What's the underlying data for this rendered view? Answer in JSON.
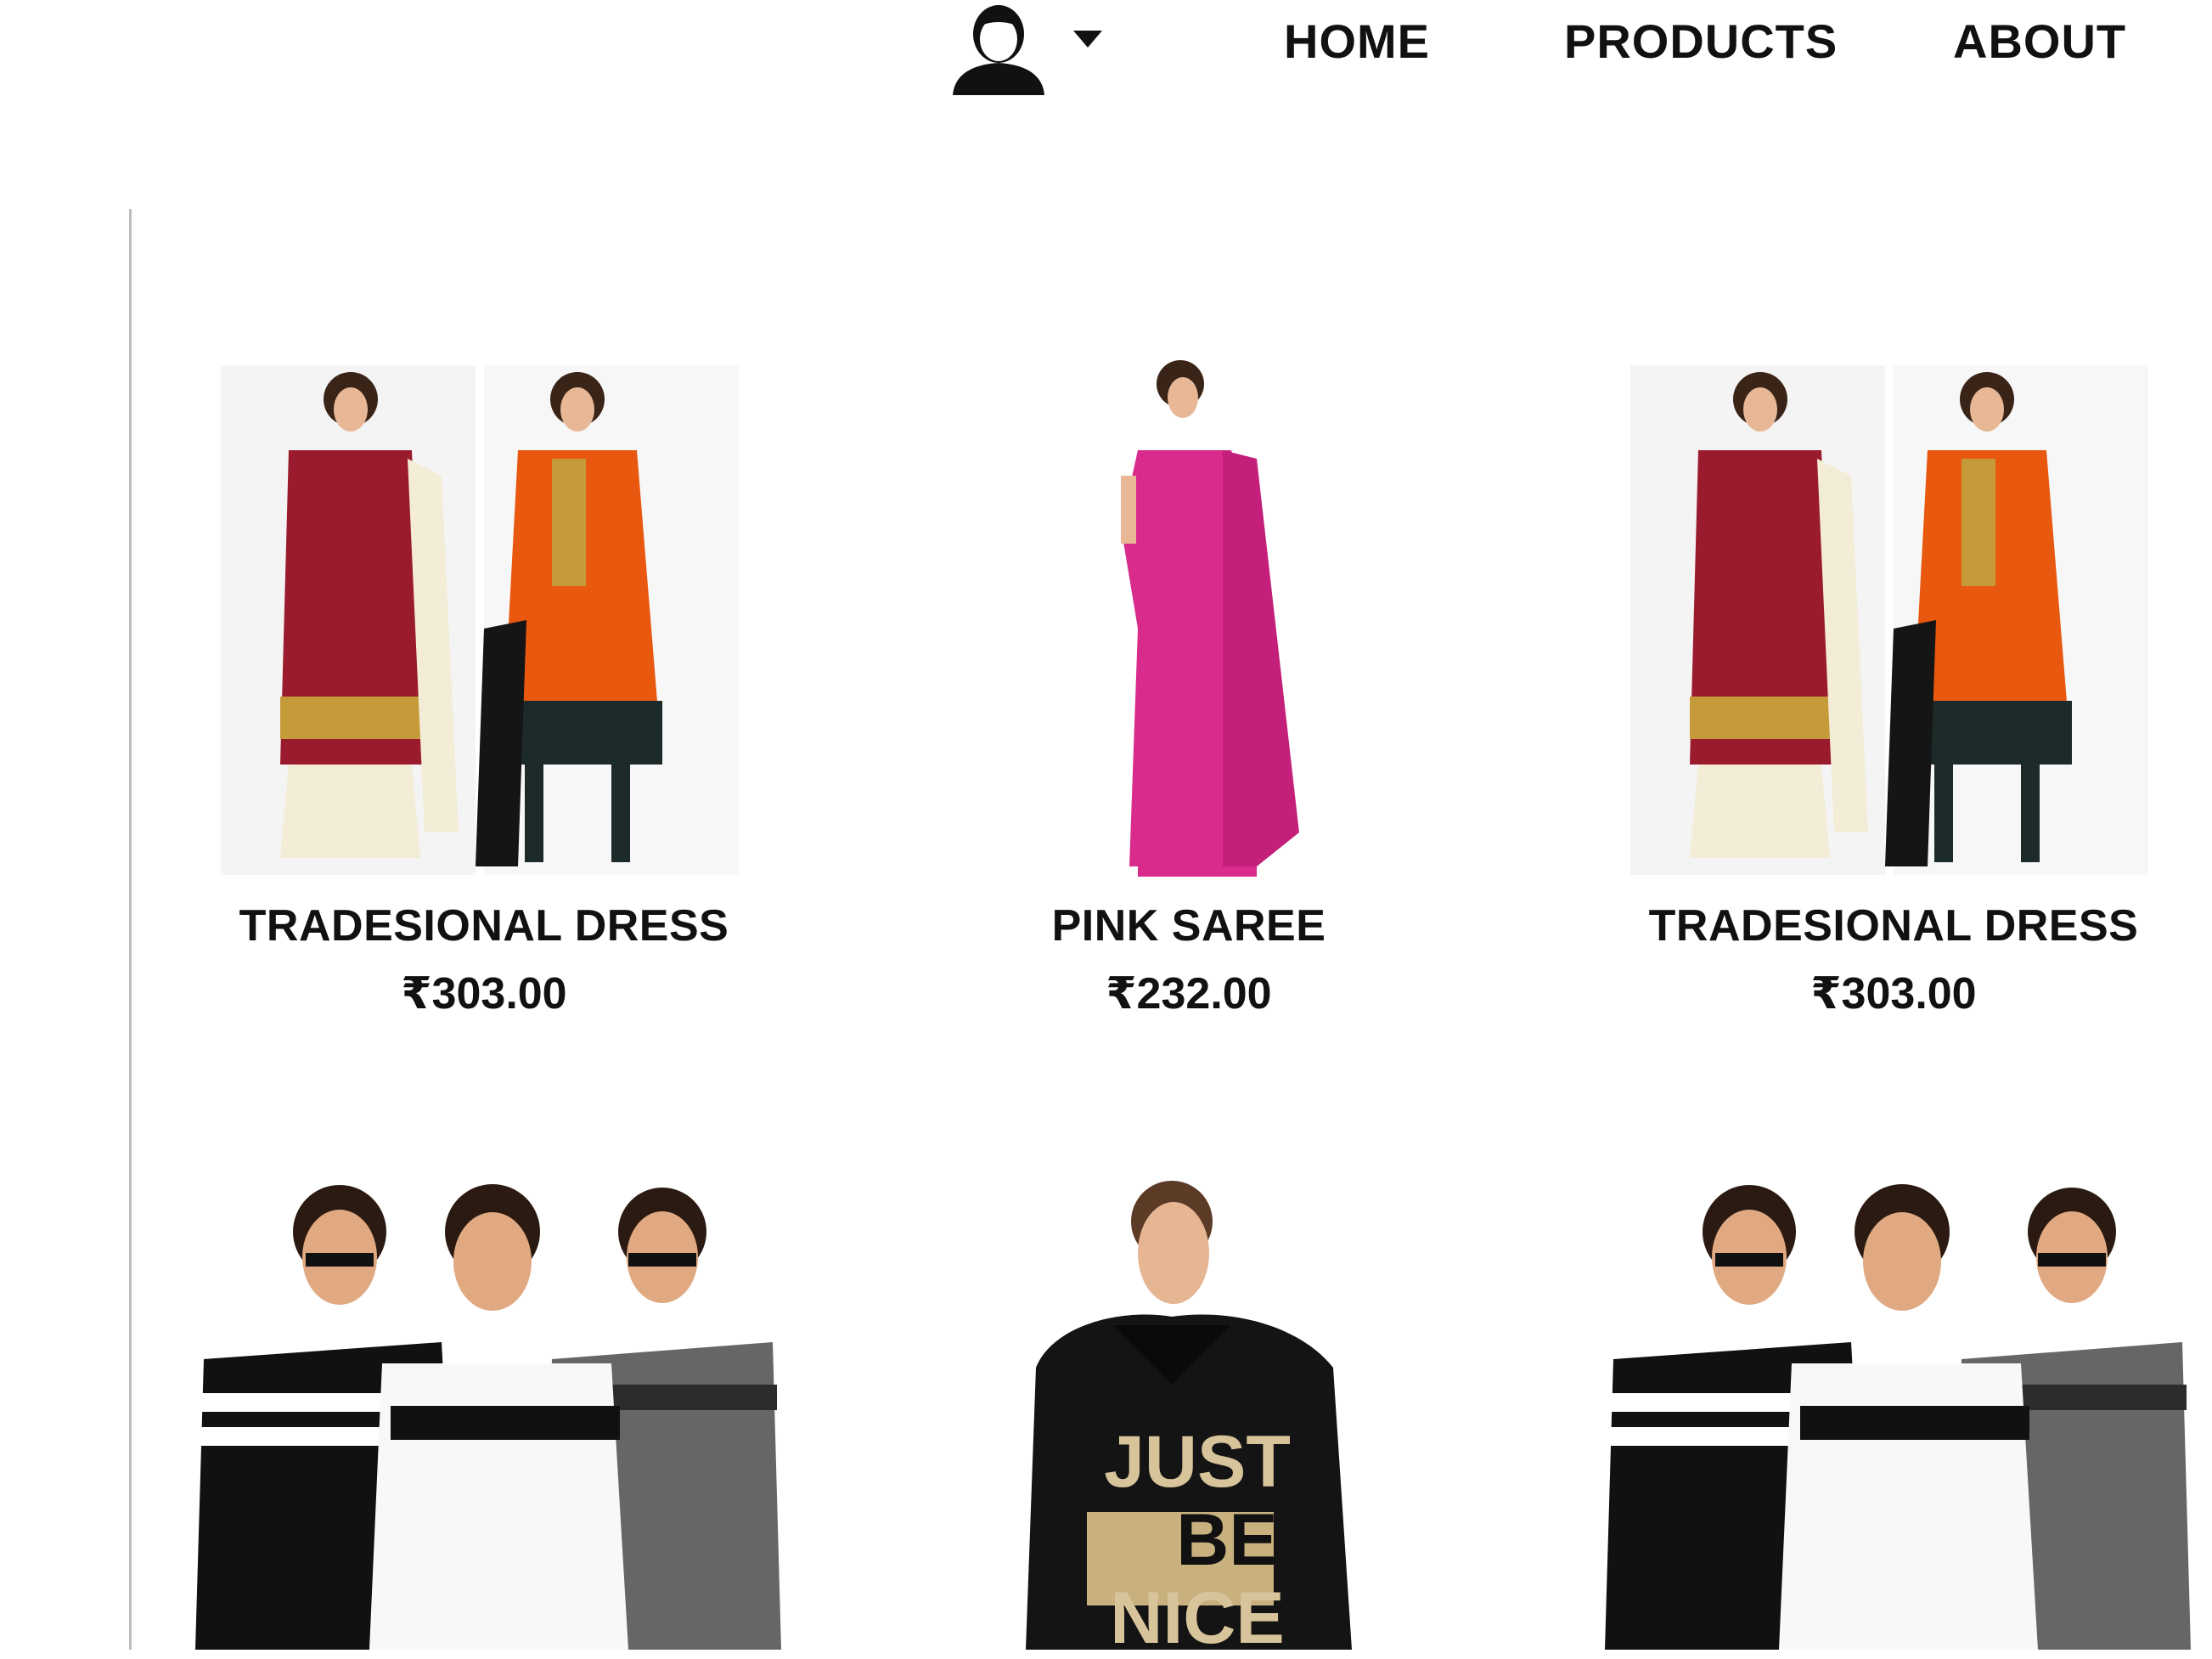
{
  "nav": {
    "user_icon": "user-avatar-icon",
    "caret_icon": "caret-down-icon",
    "links": [
      {
        "label": "HOME"
      },
      {
        "label": "PRODUCTS"
      },
      {
        "label": "ABOUT"
      }
    ]
  },
  "products": [
    {
      "title": "TRADESIONAL DRESS",
      "price": "₹303.00",
      "image": "traditional-dress-image"
    },
    {
      "title": "PINK SAREE",
      "price": "₹232.00",
      "image": "pink-saree-image"
    },
    {
      "title": "TRADESIONAL DRESS",
      "price": "₹303.00",
      "image": "traditional-dress-image"
    },
    {
      "title": "",
      "price": "",
      "image": "men-tshirts-image"
    },
    {
      "title": "",
      "price": "",
      "image": "just-be-nice-hoodie-image",
      "print_text": [
        "JUST",
        "BE",
        "NICE"
      ]
    },
    {
      "title": "",
      "price": "",
      "image": "men-tshirts-image"
    }
  ],
  "colors": {
    "text": "#111111",
    "divider": "#bdbdbd",
    "maroon": "#9b1b2e",
    "orange": "#e8580f",
    "pink": "#d92b8c",
    "gold": "#c59b3a"
  }
}
